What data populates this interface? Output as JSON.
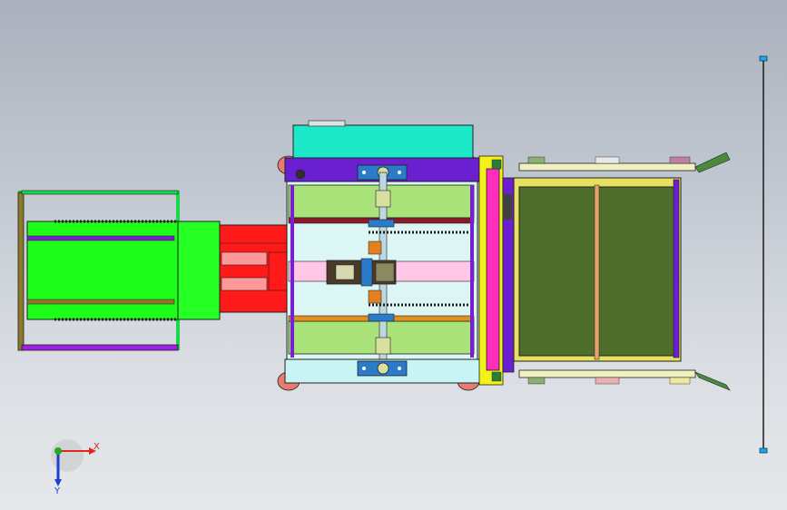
{
  "viewport": {
    "background_top": "#a9b1bd",
    "background_bottom": "#e6e8ea"
  },
  "triad": {
    "x_label": "X",
    "y_label": "Y",
    "x_color": "#e0261f",
    "y_color": "#1f3fd0",
    "origin_color": "#22aa22"
  },
  "colors": {
    "green": "#1efc1a",
    "red": "#ff1a1a",
    "purple": "#6a1fd0",
    "cyan": "#1de8c8",
    "pink": "#ff2fbd",
    "light_green": "#a9e37a",
    "dark_green": "#4f6e2c",
    "yellow": "#f2f21a",
    "light_blue": "#c8f4f6",
    "outline": "#202020"
  }
}
